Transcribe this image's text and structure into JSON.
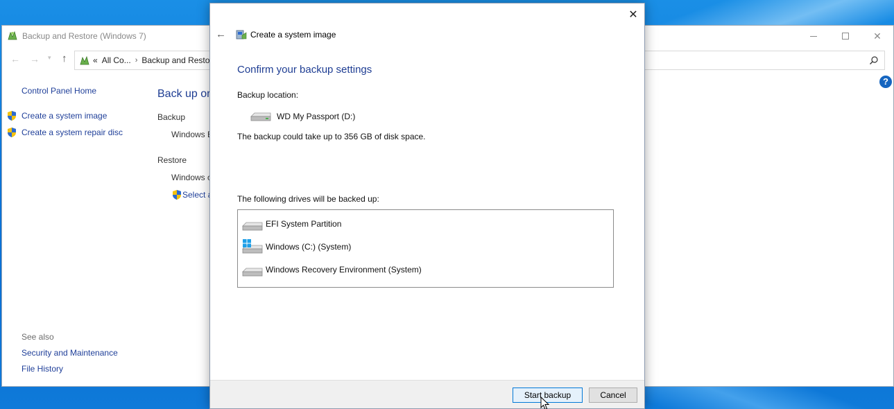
{
  "background_window": {
    "title": "Backup and Restore (Windows 7)",
    "address": {
      "prefix": "«",
      "segments": [
        "All Co...",
        "Backup and Resto"
      ]
    },
    "sidebar": {
      "home_link": "Control Panel Home",
      "tasks": [
        "Create a system image",
        "Create a system repair disc"
      ],
      "see_also_label": "See also",
      "see_also_links": [
        "Security and Maintenance",
        "File History"
      ]
    },
    "main": {
      "heading": "Back up or",
      "backup_section": "Backup",
      "backup_text": "Windows B",
      "restore_section": "Restore",
      "restore_text": "Windows c",
      "restore_link": "Select a"
    }
  },
  "dialog": {
    "title": "Create a system image",
    "heading": "Confirm your backup settings",
    "backup_location_label": "Backup location:",
    "backup_location": "WD My Passport (D:)",
    "space_note": "The backup could take up to 356 GB of disk space.",
    "drives_label": "The following drives will be backed up:",
    "drives": [
      {
        "name": "EFI System Partition",
        "icon": "drive-icon"
      },
      {
        "name": "Windows (C:) (System)",
        "icon": "windows-drive-icon"
      },
      {
        "name": "Windows Recovery Environment (System)",
        "icon": "drive-icon"
      }
    ],
    "buttons": {
      "start": "Start backup",
      "cancel": "Cancel"
    }
  },
  "colors": {
    "link": "#1f3f99",
    "heading": "#1e3d93",
    "desktop": "#0b74d8",
    "accent_button_border": "#0078d7"
  }
}
